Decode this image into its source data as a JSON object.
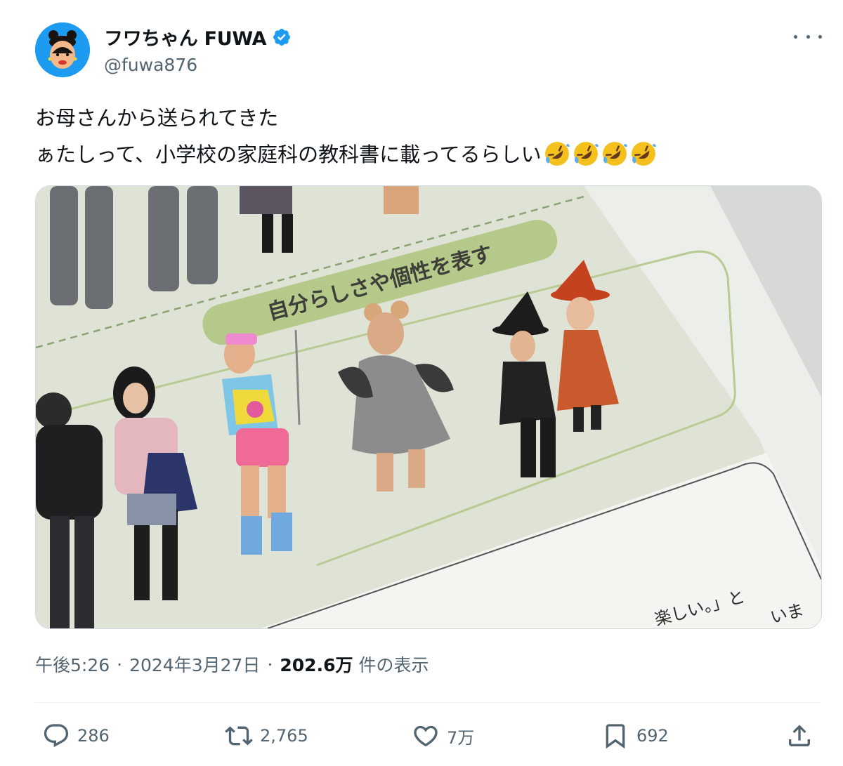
{
  "colors": {
    "accent": "#1d9bf0",
    "text": "#0f1419",
    "secondary": "#536471",
    "border": "#eff3f4"
  },
  "author": {
    "display_name": "フワちゃん FUWA",
    "handle": "@fuwa876",
    "verified": true,
    "avatar_icon": "avatar-image"
  },
  "tweet": {
    "lines": [
      "お母さんから送られてきた",
      "ぁたしって、小学校の家庭科の教科書に載ってるらしい"
    ],
    "emoji": [
      "rolling-on-floor-laughing",
      "rolling-on-floor-laughing",
      "rolling-on-floor-laughing",
      "rolling-on-floor-laughing"
    ]
  },
  "media": {
    "banner_text": "自分らしさや個性を表す",
    "page_text_1": "楽しい。」と",
    "page_text_2": "いま"
  },
  "meta": {
    "time": "午後5:26",
    "separator": "·",
    "date": "2024年3月27日",
    "views_count": "202.6万",
    "views_label": "件の表示"
  },
  "actions": {
    "reply_count": "286",
    "retweet_count": "2,765",
    "like_count": "7万",
    "bookmark_count": "692"
  },
  "icons": {
    "reply": "reply-icon",
    "retweet": "retweet-icon",
    "like": "heart-icon",
    "bookmark": "bookmark-icon",
    "share": "share-icon",
    "more": "more-icon",
    "verified": "verified-badge-icon"
  }
}
